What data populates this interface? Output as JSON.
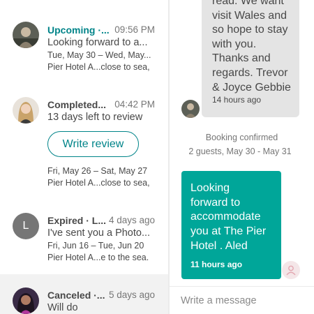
{
  "threads": [
    {
      "status": "Upcoming ·...",
      "time": "09:56 PM",
      "message": "Looking forward to a...",
      "dates": "Tue, May 30 – Wed, May...",
      "listing": "Pier Hotel A...close to sea,"
    },
    {
      "status": "Completed...",
      "time": "04:42 PM",
      "message": "13 days left to review",
      "action": "Write review",
      "dates": "Fri, May 26 – Sat, May 27",
      "listing": "Pier Hotel A...close to sea,"
    },
    {
      "status": "Expired · L...",
      "time": "4 days ago",
      "avatar_letter": "L",
      "message": "I've sent you a Photo...",
      "dates": "Fri, Jun 16 – Tue, Jun 20",
      "listing": "Pier Hotel A...e to the sea."
    },
    {
      "status": "Canceled ·...",
      "time": "5 days ago",
      "message": "Will do"
    }
  ],
  "conversation": {
    "incoming": {
      "text": "read. We want\nvisit  Wales and\nso hope to stay\nwith you.\nThanks and\nregards. Trevor\n& Joyce Gebbie",
      "time": "14 hours ago"
    },
    "booking": {
      "title": "Booking confirmed",
      "details": "2 guests, May 30 - May 31"
    },
    "outgoing": {
      "text": "Looking\nforward to\naccommodate\nyou at The Pier\nHotel . Aled",
      "time": "11 hours ago"
    },
    "compose_placeholder": "Write a message"
  },
  "colors": {
    "accent_teal": "#008489",
    "bubble_out": "#00a699",
    "bubble_in": "#e4e4e4",
    "active_thread_bg": "#f2f2f2"
  },
  "icons": {
    "host_avatar": "user-silhouette-icon"
  }
}
